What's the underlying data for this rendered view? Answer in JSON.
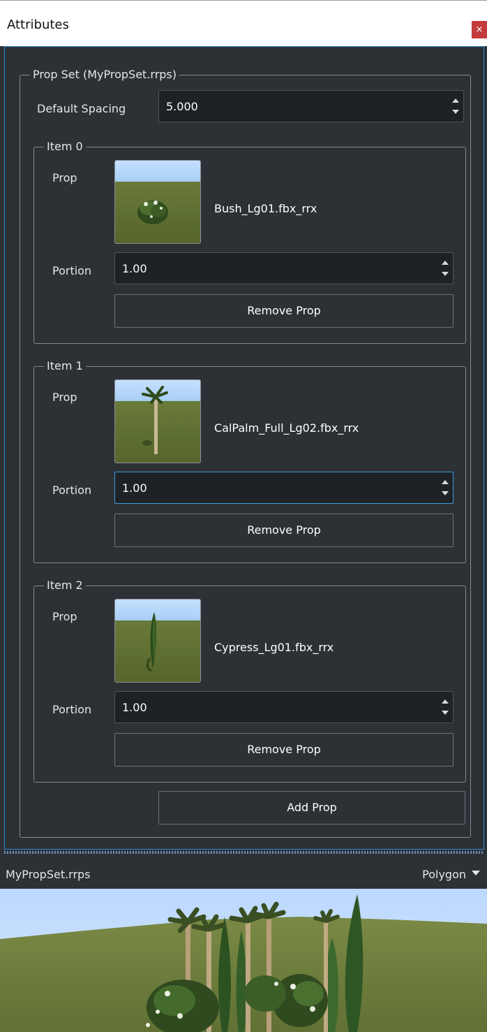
{
  "window": {
    "title": "Attributes",
    "close_glyph": "×"
  },
  "propset": {
    "legend": "Prop Set (MyPropSet.rrps)",
    "default_spacing_label": "Default Spacing",
    "default_spacing_value": "5.000",
    "items": [
      {
        "legend": "Item 0",
        "prop_label": "Prop",
        "file": "Bush_Lg01.fbx_rrx",
        "portion_label": "Portion",
        "portion": "1.00",
        "remove_label": "Remove Prop"
      },
      {
        "legend": "Item 1",
        "prop_label": "Prop",
        "file": "CalPalm_Full_Lg02.fbx_rrx",
        "portion_label": "Portion",
        "portion": "1.00",
        "remove_label": "Remove Prop"
      },
      {
        "legend": "Item 2",
        "prop_label": "Prop",
        "file": "Cypress_Lg01.fbx_rrx",
        "portion_label": "Portion",
        "portion": "1.00",
        "remove_label": "Remove Prop"
      }
    ],
    "add_label": "Add Prop"
  },
  "preview_bar": {
    "name": "MyPropSet.rrps",
    "mode": "Polygon"
  },
  "icons": {
    "close": "close-icon",
    "spin_up": "spin-up-icon",
    "spin_down": "spin-down-icon",
    "dropdown": "chevron-down-icon"
  },
  "colors": {
    "accent": "#2e8fd0",
    "close_bg": "#c43b3b",
    "panel_bg": "#2d3035",
    "field_bg": "#1e2125"
  }
}
